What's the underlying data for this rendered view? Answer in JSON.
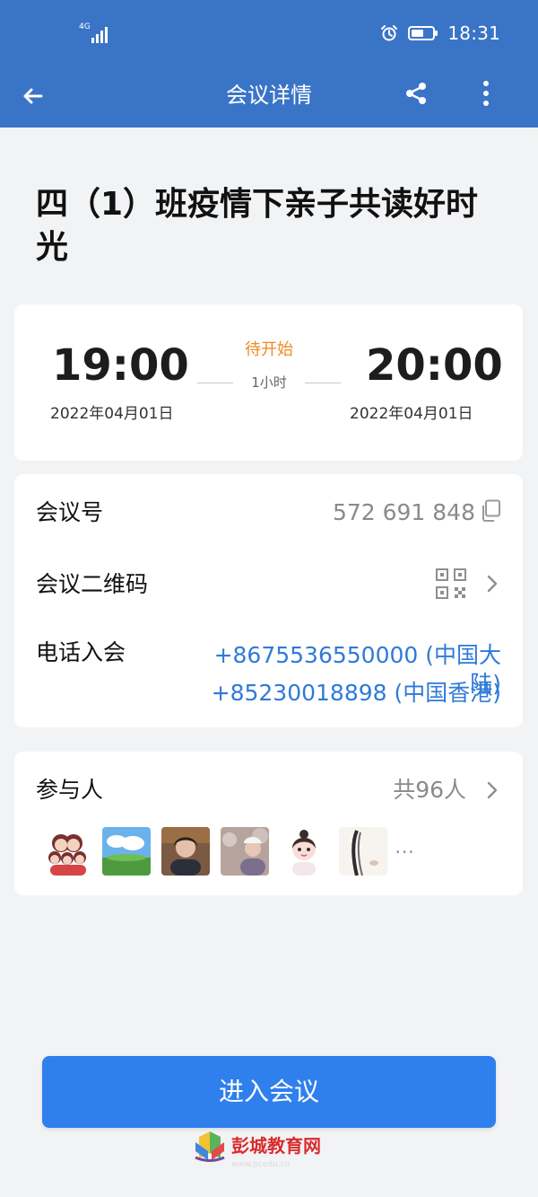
{
  "status_bar": {
    "network_text": "4G",
    "time": "18:31"
  },
  "app_bar": {
    "title": "会议详情",
    "back_icon": "back-arrow-icon",
    "share_icon": "share-icon",
    "more_icon": "more-icon"
  },
  "meeting": {
    "title": "四（1）班疫情下亲子共读好时光",
    "start_time": "19:00",
    "start_date": "2022年04月01日",
    "end_time": "20:00",
    "end_date": "2022年04月01日",
    "status": "待开始",
    "duration": "1小时"
  },
  "details": {
    "meeting_id_label": "会议号",
    "meeting_id_value": "572 691 848",
    "qr_label": "会议二维码",
    "phone_label": "电话入会",
    "phone_numbers": [
      "+8675536550000 (中国大陆)",
      "+85230018898 (中国香港)"
    ]
  },
  "participants": {
    "label": "参与人",
    "count_text": "共96人",
    "more_text": "…"
  },
  "actions": {
    "enter_button": "进入会议"
  },
  "watermark": {
    "brand": "彭城教育网",
    "website": "www.pcedu.cn"
  },
  "colors": {
    "app_bar": "#3a74c7",
    "page_bg": "#f2f3f5",
    "accent_blue": "#2f7ad8",
    "button_blue": "#2f80ed",
    "status_orange": "#f08a24"
  }
}
